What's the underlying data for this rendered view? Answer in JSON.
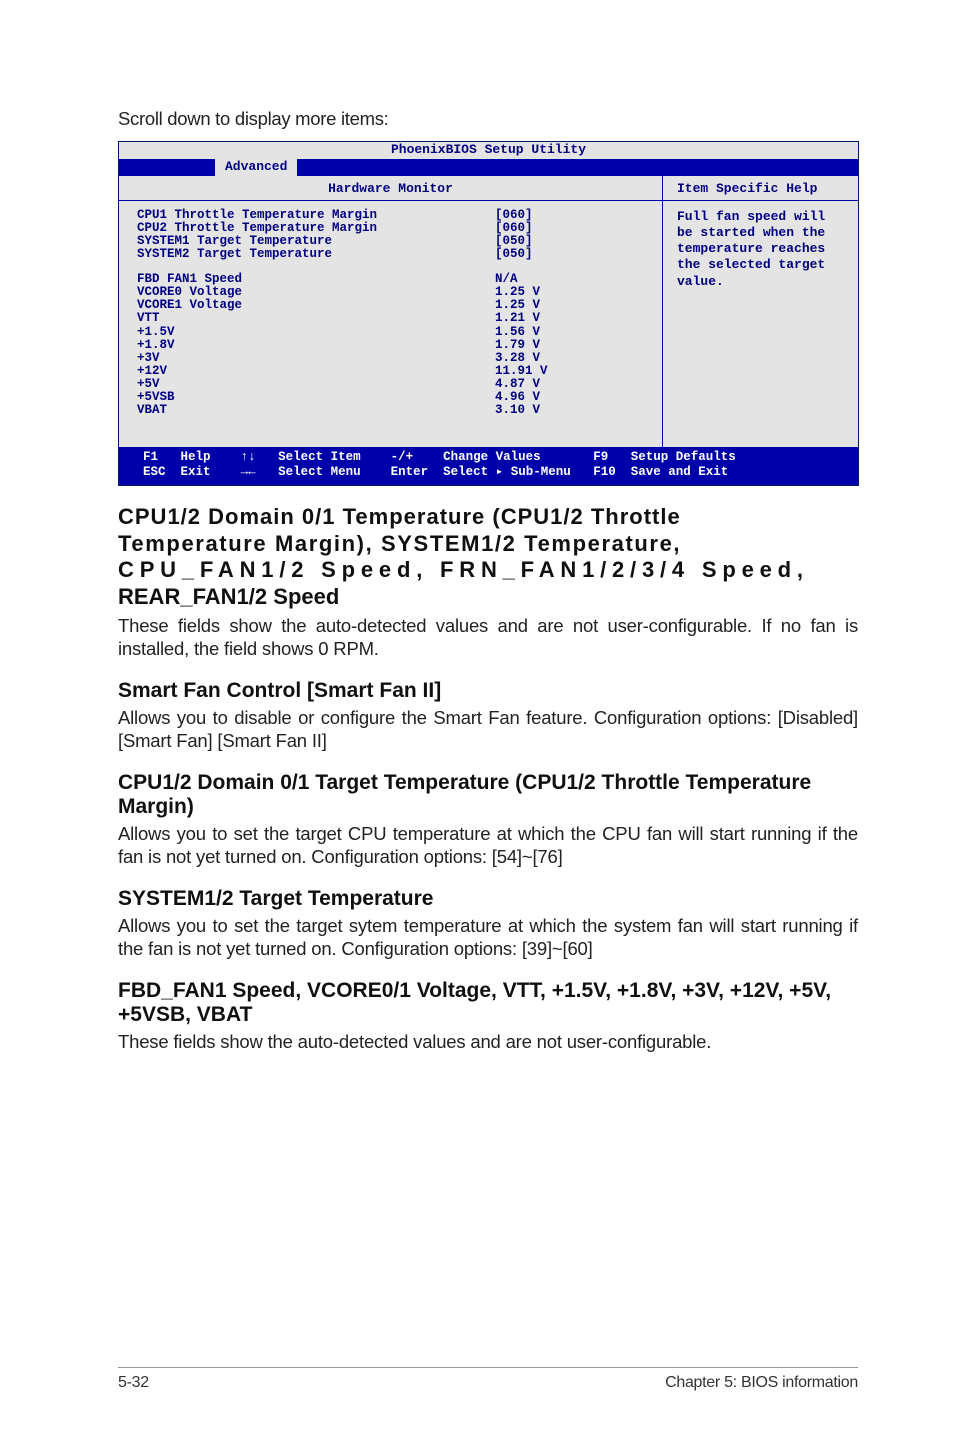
{
  "intro": "Scroll down to display more items:",
  "bios": {
    "title": "PhoenixBIOS Setup Utility",
    "tab": "Advanced",
    "panel_title": "Hardware Monitor",
    "help_title": "Item Specific Help",
    "help_body": "Full fan speed will be started when the temperature reaches the selected target value.",
    "rows_a": [
      {
        "label": "CPU1 Throttle Temperature Margin",
        "value": "[060]"
      },
      {
        "label": "CPU2 Throttle Temperature Margin",
        "value": "[060]"
      },
      {
        "label": "SYSTEM1 Target Temperature",
        "value": "[050]"
      },
      {
        "label": "SYSTEM2 Target Temperature",
        "value": "[050]"
      }
    ],
    "rows_b": [
      {
        "label": "FBD FAN1 Speed",
        "value": "N/A"
      },
      {
        "label": "VCORE0 Voltage",
        "value": "1.25 V"
      },
      {
        "label": "VCORE1 Voltage",
        "value": "1.25 V"
      },
      {
        "label": "VTT",
        "value": "1.21 V"
      },
      {
        "label": "+1.5V",
        "value": "1.56 V"
      },
      {
        "label": "+1.8V",
        "value": "1.79 V"
      },
      {
        "label": "+3V",
        "value": "3.28 V"
      },
      {
        "label": "+12V",
        "value": "11.91 V"
      },
      {
        "label": "+5V",
        "value": "4.87 V"
      },
      {
        "label": "+5VSB",
        "value": "4.96 V"
      },
      {
        "label": "VBAT",
        "value": "3.10 V"
      }
    ],
    "footer": {
      "f1": "F1",
      "help": "Help",
      "updown": "↑↓",
      "select_item": "Select Item",
      "pm": "-/+",
      "change_values": "Change Values",
      "f9": "F9",
      "setup_defaults": "Setup Defaults",
      "esc": "ESC",
      "exit": "Exit",
      "lr": "→←",
      "select_menu": "Select Menu",
      "enter": "Enter",
      "select_sub": "Select ▸ Sub-Menu",
      "f10": "F10",
      "save_exit": "Save and Exit"
    }
  },
  "sec1": {
    "h_l1": "CPU1/2 Domain 0/1 Temperature (CPU1/2 Throttle",
    "h_l2": "Temperature Margin), SYSTEM1/2 Temperature,",
    "h_l3": "CPU_FAN1/2 Speed, FRN_FAN1/2/3/4 Speed,",
    "h_l4": "REAR_FAN1/2 Speed",
    "p": "These fields show the auto-detected values and are not user-configurable. If no fan is installed, the field shows 0 RPM."
  },
  "sec2": {
    "h": "Smart Fan Control [Smart Fan II]",
    "p": "Allows you to disable or configure the Smart Fan feature. Configuration options: [Disabled] [Smart Fan] [Smart Fan II]"
  },
  "sec3": {
    "h": "CPU1/2 Domain 0/1 Target Temperature (CPU1/2 Throttle Temperature Margin)",
    "p": "Allows you to set the target CPU temperature at which the CPU fan will start running if the fan is not yet turned on. Configuration options: [54]~[76]"
  },
  "sec4": {
    "h": "SYSTEM1/2 Target Temperature",
    "p": "Allows you to set the target sytem temperature at which the system fan will start running if the fan is not yet turned on. Configuration options: [39]~[60]"
  },
  "sec5": {
    "h": "FBD_FAN1 Speed, VCORE0/1 Voltage, VTT, +1.5V, +1.8V, +3V, +12V, +5V, +5VSB, VBAT",
    "p": "These fields show the auto-detected values and are not user-configurable."
  },
  "page_footer": {
    "left": "5-32",
    "right": "Chapter 5: BIOS information"
  }
}
